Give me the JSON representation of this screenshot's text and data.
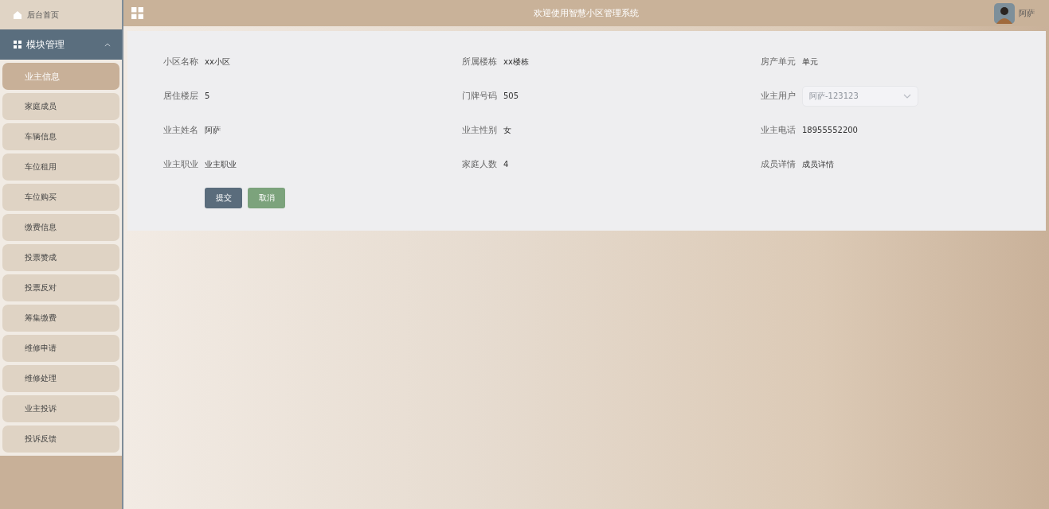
{
  "sidebar": {
    "home": {
      "label": "后台首页"
    },
    "group": {
      "label": "模块管理",
      "expanded": true
    },
    "items": [
      {
        "label": "业主信息",
        "selected": true
      },
      {
        "label": "家庭成员",
        "selected": false
      },
      {
        "label": "车辆信息",
        "selected": false
      },
      {
        "label": "车位租用",
        "selected": false
      },
      {
        "label": "车位购买",
        "selected": false
      },
      {
        "label": "缴费信息",
        "selected": false
      },
      {
        "label": "投票赞成",
        "selected": false
      },
      {
        "label": "投票反对",
        "selected": false
      },
      {
        "label": "筹集缴费",
        "selected": false
      },
      {
        "label": "维修申请",
        "selected": false
      },
      {
        "label": "维修处理",
        "selected": false
      },
      {
        "label": "业主投诉",
        "selected": false
      },
      {
        "label": "投诉反馈",
        "selected": false
      }
    ]
  },
  "header": {
    "title": "欢迎使用智慧小区管理系统",
    "user": "阿萨"
  },
  "form": {
    "fields": [
      {
        "label": "小区名称",
        "value": "xx小区",
        "kind": "text"
      },
      {
        "label": "所属楼栋",
        "value": "xx楼栋",
        "kind": "text"
      },
      {
        "label": "房产单元",
        "value": "单元",
        "kind": "text"
      },
      {
        "label": "居住楼层",
        "value": "5",
        "kind": "text"
      },
      {
        "label": "门牌号码",
        "value": "505",
        "kind": "text"
      },
      {
        "label": "业主用户",
        "value": "阿萨-123123",
        "kind": "select",
        "disabled": true
      },
      {
        "label": "业主姓名",
        "value": "阿萨",
        "kind": "text"
      },
      {
        "label": "业主性别",
        "value": "女",
        "kind": "text"
      },
      {
        "label": "业主电话",
        "value": "18955552200",
        "kind": "text"
      },
      {
        "label": "业主职业",
        "value": "业主职业",
        "kind": "text"
      },
      {
        "label": "家庭人数",
        "value": "4",
        "kind": "text"
      },
      {
        "label": "成员详情",
        "value": "成员详情",
        "kind": "text"
      }
    ],
    "buttons": [
      {
        "label": "提交",
        "kind": "primary"
      },
      {
        "label": "取消",
        "kind": "secondary"
      }
    ]
  }
}
